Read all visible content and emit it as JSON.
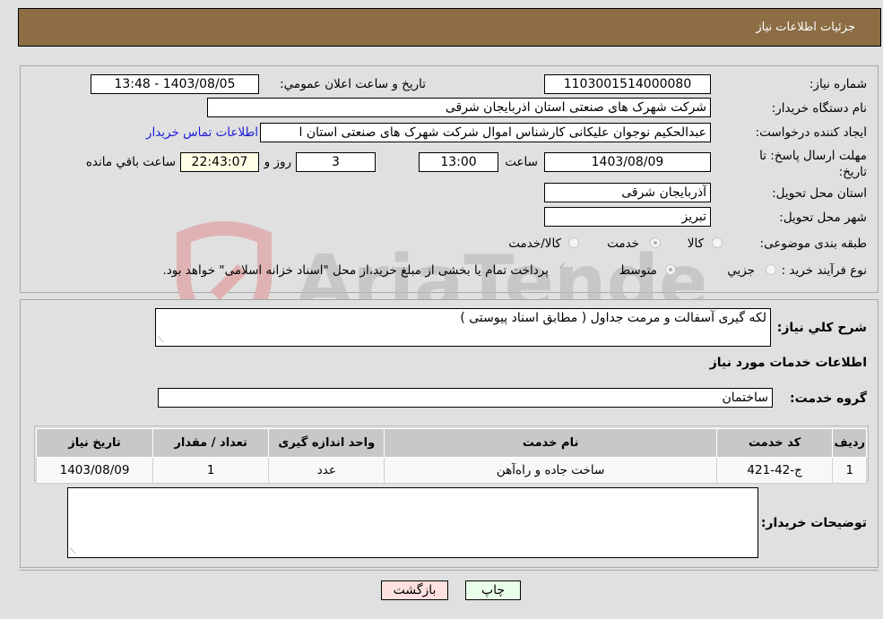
{
  "header": {
    "title": "جزئيات اطلاعات نياز"
  },
  "form": {
    "need_number": {
      "label": "شماره نياز:",
      "value": "1103001514000080"
    },
    "announce_datetime": {
      "label": "تاريخ و ساعت اعلان عمومي:",
      "value": "1403/08/05 - 13:48"
    },
    "buyer_org": {
      "label": "نام دستگاه خريدار:",
      "value": "شرکت شهرک های صنعتی استان اذربایجان شرقی"
    },
    "requester": {
      "label": "ايجاد کننده درخواست:",
      "value": "عبدالحکیم نوجوان علیکانی کارشناس اموال شرکت شهرک های صنعتی استان ا"
    },
    "buyer_contact_link": "اطلاعات تماس خريدار",
    "deadline": {
      "label": "مهلت ارسال پاسخ: تا تاريخ:",
      "date": "1403/08/09",
      "time_label": "ساعت",
      "time": "13:00",
      "days": "3",
      "days_label": "روز و",
      "remaining": "22:43:07",
      "remaining_label": "ساعت باقي مانده"
    },
    "delivery_province": {
      "label": "استان محل تحويل:",
      "value": "آذربایجان شرقی"
    },
    "delivery_city": {
      "label": "شهر محل تحويل:",
      "value": "تبریز"
    },
    "category": {
      "label": "طبقه بندی موضوعی:",
      "options": [
        "کالا",
        "خدمت",
        "کالا/خدمت"
      ],
      "selected": "خدمت"
    },
    "purchase_type": {
      "label": "نوع فرآيند خريد :",
      "options": [
        "جزيي",
        "متوسط"
      ],
      "selected": "متوسط",
      "payment_note": "پرداخت تمام يا بخشی از مبلغ خريد،از محل \"اسناد خزانه اسلامی\" خواهد بود.",
      "payment_checked": true
    }
  },
  "description": {
    "label": "شرح کلي نياز:",
    "value": "لکه گیری آسفالت و مرمت جداول ( مطابق اسناد پیوستی )"
  },
  "services": {
    "section_title": "اطلاعات خدمات مورد نياز",
    "group_label": "گروه خدمت:",
    "group_value": "ساختمان",
    "columns": [
      "رديف",
      "کد خدمت",
      "نام خدمت",
      "واحد اندازه گيری",
      "تعداد / مقدار",
      "تاريخ نياز"
    ],
    "rows": [
      [
        "1",
        "ج-42-421",
        "ساخت جاده و راه‌آهن",
        "عدد",
        "1",
        "1403/08/09"
      ]
    ]
  },
  "buyer_notes": {
    "label": "توضيحات خريدار:",
    "value": ""
  },
  "buttons": {
    "print": "چاپ",
    "back": "بازگشت"
  },
  "watermark": {
    "text": "AriaTender.neT"
  },
  "colors": {
    "header_bg": "#8c6d44",
    "print_btn_bg": "#eaffea",
    "back_btn_bg": "#ffe0e0",
    "link": "#1a1adb",
    "remaining_bg": "#ffffe6"
  }
}
